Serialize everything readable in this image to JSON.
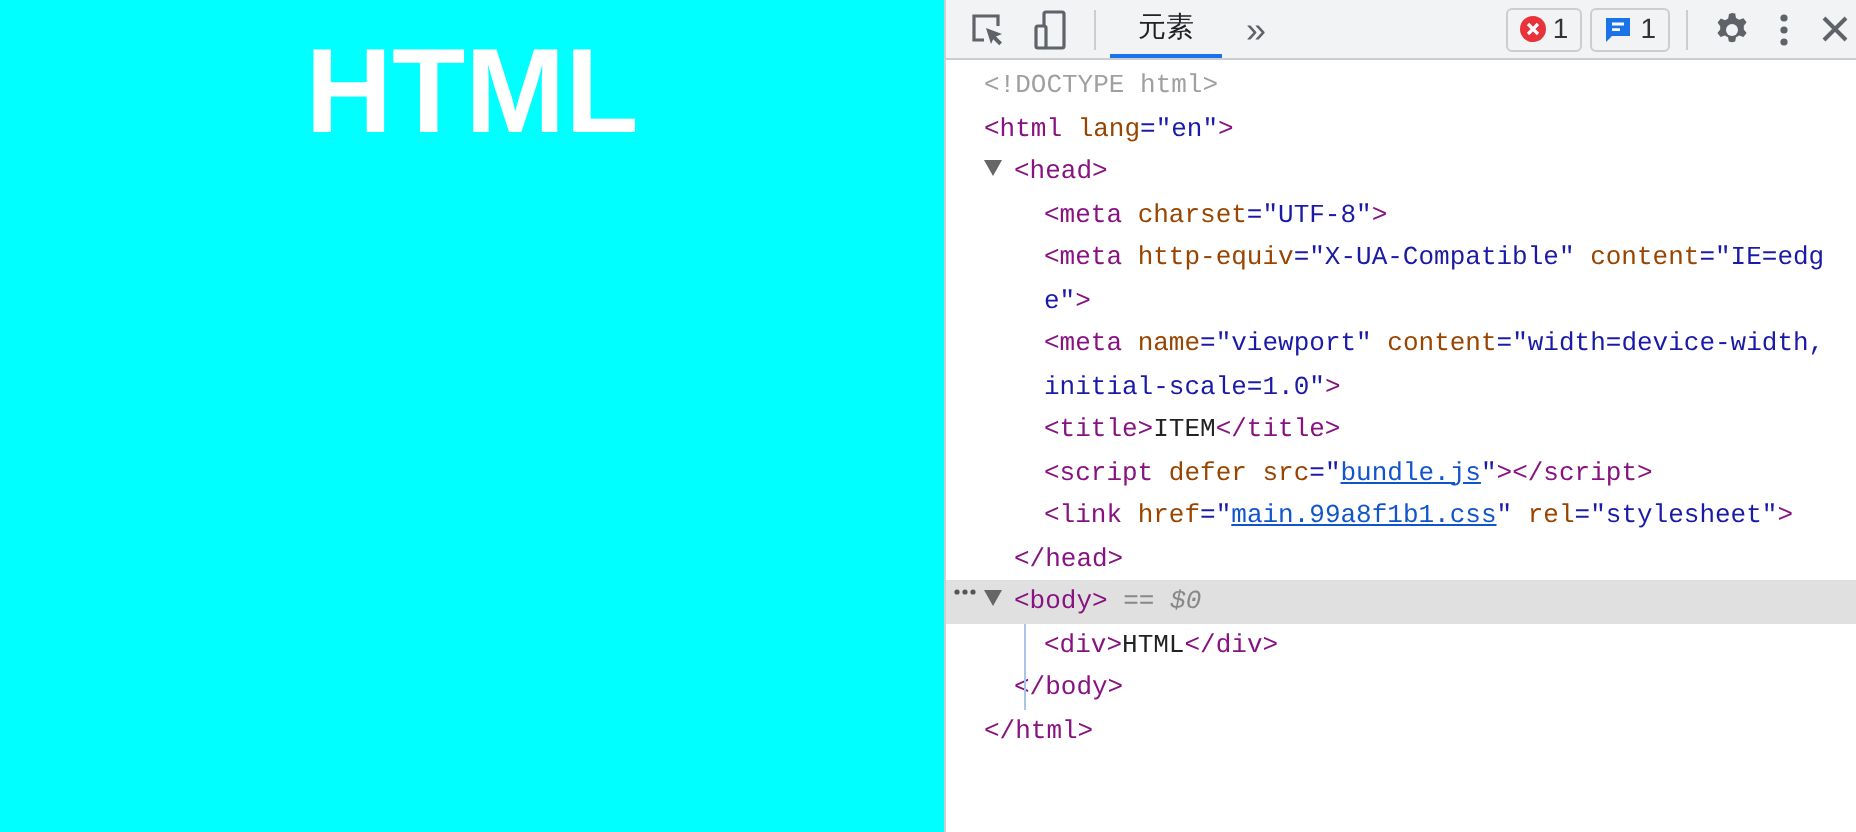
{
  "page": {
    "heading": "HTML"
  },
  "toolbar": {
    "tabs": [
      {
        "label": "元素",
        "selected": true
      }
    ],
    "more": "»",
    "errors": "1",
    "messages": "1"
  },
  "tree": [
    {
      "selected": false,
      "lines": [
        [
          {
            "kind": "doctype",
            "text": "<!DOCTYPE html>"
          }
        ]
      ]
    },
    {
      "selected": false,
      "lines": [
        [
          {
            "kind": "tag",
            "text": "<html "
          },
          {
            "kind": "attr",
            "text": "lang"
          },
          {
            "kind": "value",
            "text": "=\"en\""
          },
          {
            "kind": "tag",
            "text": ">"
          }
        ]
      ],
      "close": [
        {
          "kind": "tag",
          "text": "</html>"
        }
      ],
      "children": [
        {
          "selected": false,
          "expanded": true,
          "lines": [
            [
              {
                "kind": "tag",
                "text": "<head>"
              }
            ]
          ],
          "close": [
            {
              "kind": "tag",
              "text": "</head>"
            }
          ],
          "children": [
            {
              "selected": false,
              "lines": [
                [
                  {
                    "kind": "tag",
                    "text": "<meta "
                  },
                  {
                    "kind": "attr",
                    "text": "charset"
                  },
                  {
                    "kind": "value",
                    "text": "=\"UTF-8\""
                  },
                  {
                    "kind": "tag",
                    "text": ">"
                  }
                ]
              ]
            },
            {
              "selected": false,
              "lines": [
                [
                  {
                    "kind": "tag",
                    "text": "<meta "
                  },
                  {
                    "kind": "attr",
                    "text": "http-equiv"
                  },
                  {
                    "kind": "value",
                    "text": "=\"X-UA-Compatible\""
                  },
                  {
                    "kind": "attr",
                    "text": " content"
                  },
                  {
                    "kind": "value",
                    "text": "=\"IE=edg"
                  }
                ],
                [
                  {
                    "kind": "value",
                    "text": "e\""
                  },
                  {
                    "kind": "tag",
                    "text": ">"
                  }
                ]
              ]
            },
            {
              "selected": false,
              "lines": [
                [
                  {
                    "kind": "tag",
                    "text": "<meta "
                  },
                  {
                    "kind": "attr",
                    "text": "name"
                  },
                  {
                    "kind": "value",
                    "text": "=\"viewport\""
                  },
                  {
                    "kind": "attr",
                    "text": " content"
                  },
                  {
                    "kind": "value",
                    "text": "=\"width=device-width,"
                  }
                ],
                [
                  {
                    "kind": "value",
                    "text": "initial-scale=1.0\""
                  },
                  {
                    "kind": "tag",
                    "text": ">"
                  }
                ]
              ]
            },
            {
              "selected": false,
              "lines": [
                [
                  {
                    "kind": "tag",
                    "text": "<title>"
                  },
                  {
                    "kind": "text",
                    "text": "ITEM"
                  },
                  {
                    "kind": "tag",
                    "text": "</title>"
                  }
                ]
              ]
            },
            {
              "selected": false,
              "lines": [
                [
                  {
                    "kind": "tag",
                    "text": "<script "
                  },
                  {
                    "kind": "attr",
                    "text": "defer src"
                  },
                  {
                    "kind": "value",
                    "text": "=\""
                  },
                  {
                    "kind": "link",
                    "text": "bundle.js"
                  },
                  {
                    "kind": "value",
                    "text": "\""
                  },
                  {
                    "kind": "tag",
                    "text": "></script>"
                  }
                ]
              ]
            },
            {
              "selected": false,
              "lines": [
                [
                  {
                    "kind": "tag",
                    "text": "<link "
                  },
                  {
                    "kind": "attr",
                    "text": "href"
                  },
                  {
                    "kind": "value",
                    "text": "=\""
                  },
                  {
                    "kind": "link",
                    "text": "main.99a8f1b1.css"
                  },
                  {
                    "kind": "value",
                    "text": "\""
                  },
                  {
                    "kind": "attr",
                    "text": " rel"
                  },
                  {
                    "kind": "value",
                    "text": "=\"stylesheet\""
                  },
                  {
                    "kind": "tag",
                    "text": ">"
                  }
                ]
              ]
            }
          ]
        },
        {
          "selected": true,
          "expanded": true,
          "lines": [
            [
              {
                "kind": "tag",
                "text": "<body>"
              },
              {
                "kind": "hint",
                "text": " == $0"
              }
            ]
          ],
          "close": [
            {
              "kind": "tag",
              "text": "</body>"
            }
          ],
          "children": [
            {
              "selected": false,
              "lines": [
                [
                  {
                    "kind": "tag",
                    "text": "<div>"
                  },
                  {
                    "kind": "text",
                    "text": "HTML"
                  },
                  {
                    "kind": "tag",
                    "text": "</div>"
                  }
                ]
              ]
            }
          ]
        }
      ]
    }
  ]
}
